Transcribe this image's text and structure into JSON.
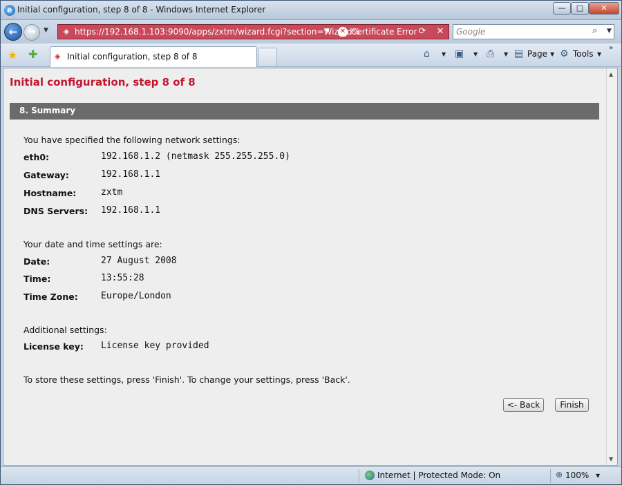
{
  "window": {
    "title": "Initial configuration, step 8 of 8 - Windows Internet Explorer",
    "min_glyph": "—",
    "max_glyph": "□",
    "close_glyph": "✕"
  },
  "address_bar": {
    "url": "https://192.168.1.103:9090/apps/zxtm/wizard.fcgi?section=Wizard%",
    "certificate_error": "Certificate Error",
    "search_placeholder": "Google"
  },
  "tab": {
    "label": "Initial configuration, step 8 of 8"
  },
  "command_bar": {
    "page_label": "Page",
    "tools_label": "Tools"
  },
  "page": {
    "title": "Initial configuration, step 8 of 8",
    "section_title": "8. Summary",
    "network": {
      "intro": "You have specified the following network settings:",
      "rows": [
        {
          "label": "eth0:",
          "value": "192.168.1.2 (netmask 255.255.255.0)"
        },
        {
          "label": "Gateway:",
          "value": "192.168.1.1"
        },
        {
          "label": "Hostname:",
          "value": "zxtm"
        },
        {
          "label": "DNS Servers:",
          "value": "192.168.1.1"
        }
      ]
    },
    "datetime": {
      "intro": "Your date and time settings are:",
      "rows": [
        {
          "label": "Date:",
          "value": "27 August 2008"
        },
        {
          "label": "Time:",
          "value": "13:55:28"
        },
        {
          "label": "Time Zone:",
          "value": "Europe/London"
        }
      ]
    },
    "additional": {
      "intro": "Additional settings:",
      "rows": [
        {
          "label": "License key:",
          "value": "License key provided"
        }
      ]
    },
    "instructions": "To store these settings, press 'Finish'. To change your settings, press 'Back'.",
    "back_button": "<- Back",
    "finish_button": "Finish"
  },
  "status_bar": {
    "zone": "Internet | Protected Mode: On",
    "zoom": "100%"
  }
}
